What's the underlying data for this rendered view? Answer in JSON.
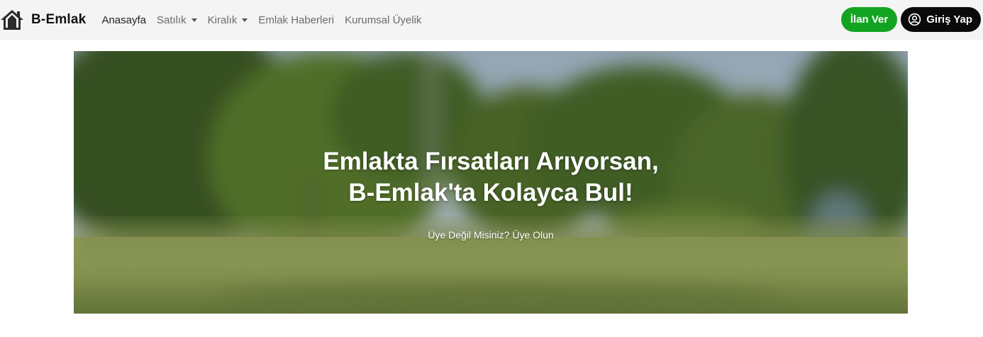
{
  "brand": {
    "name": "B-Emlak",
    "icon": "house-icon"
  },
  "nav": {
    "items": [
      {
        "label": "Anasayfa",
        "active": true
      },
      {
        "label": "Satılık",
        "dropdown": true
      },
      {
        "label": "Kiralık",
        "dropdown": true
      },
      {
        "label": "Emlak Haberleri"
      },
      {
        "label": "Kurumsal Üyelik"
      }
    ]
  },
  "actions": {
    "ilan_ver": "İlan Ver",
    "giris_yap": "Giriş Yap",
    "ilan_color": "#12a320",
    "giris_color": "#0a0a0a",
    "user_icon": "user-circle-icon"
  },
  "hero": {
    "title_line1": "Emlakta Fırsatları Arıyorsan,",
    "title_line2": "B-Emlak'ta Kolayca Bul!",
    "register_link": "Üye Değil Misiniz? Üye Olun"
  }
}
